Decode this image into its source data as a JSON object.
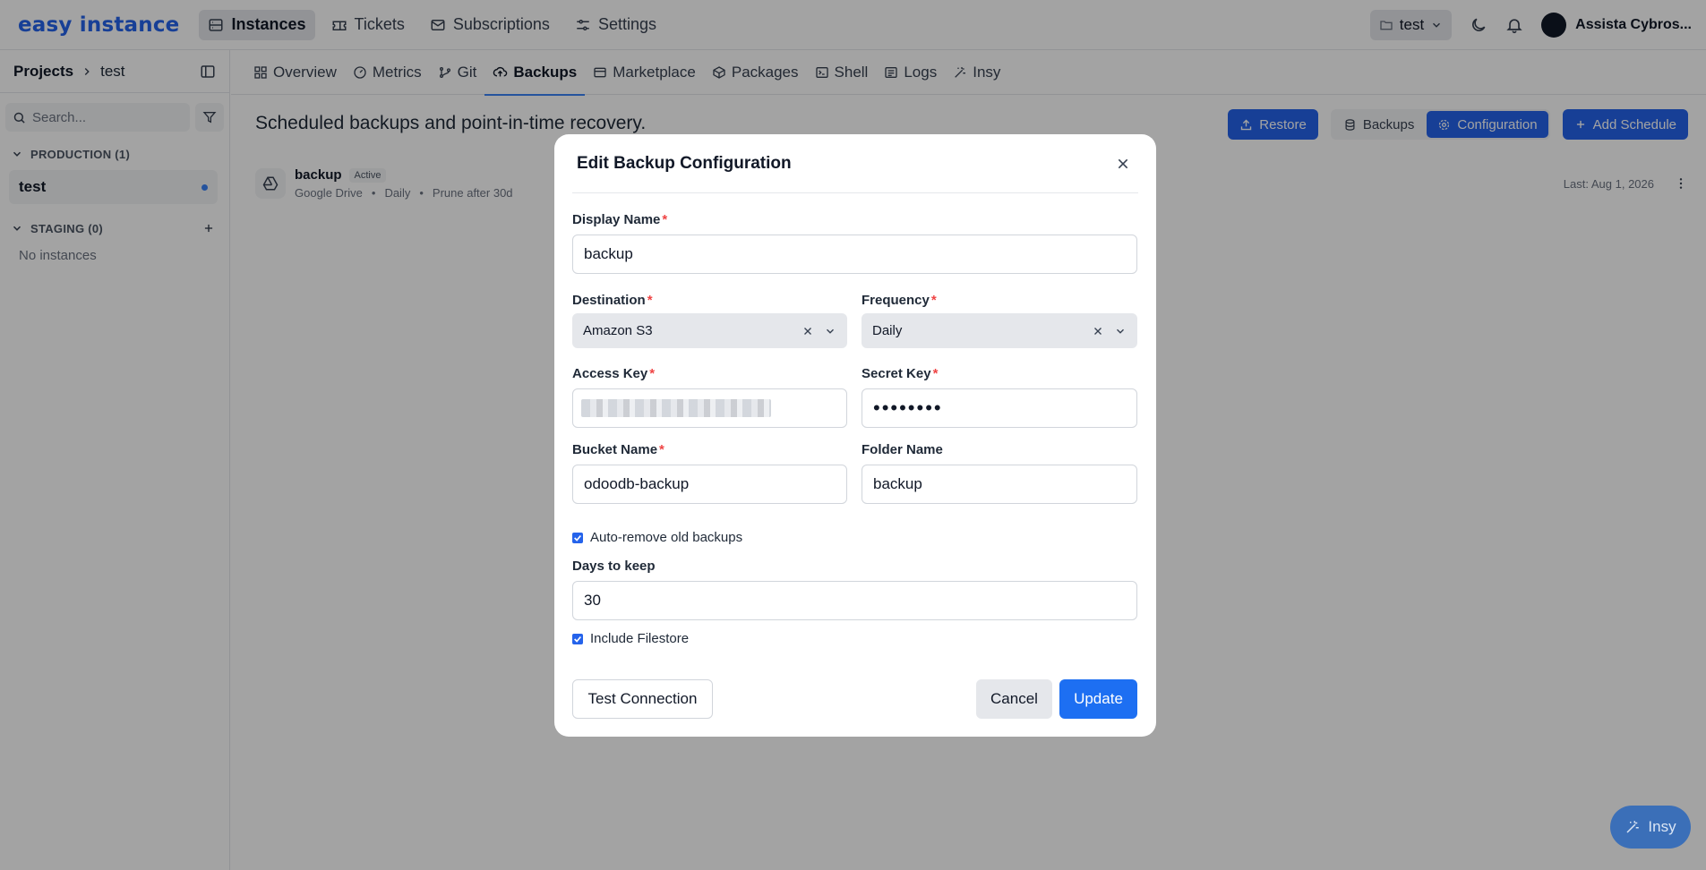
{
  "app": {
    "logo": "easy instance"
  },
  "topnav": {
    "items": [
      {
        "label": "Instances",
        "icon": "server-icon",
        "active": true
      },
      {
        "label": "Tickets",
        "icon": "ticket-icon"
      },
      {
        "label": "Subscriptions",
        "icon": "mail-icon"
      },
      {
        "label": "Settings",
        "icon": "sliders-icon"
      }
    ],
    "project": "test",
    "user": "Assista Cybros..."
  },
  "sidebar": {
    "breadcrumb_root": "Projects",
    "breadcrumb_current": "test",
    "search_placeholder": "Search...",
    "groups": [
      {
        "label": "PRODUCTION (1)",
        "instances": [
          "test"
        ]
      },
      {
        "label": "STAGING (0)",
        "empty": "No instances"
      }
    ]
  },
  "tabs": [
    "Overview",
    "Metrics",
    "Git",
    "Backups",
    "Marketplace",
    "Packages",
    "Shell",
    "Logs",
    "Insy"
  ],
  "active_tab": "Backups",
  "main": {
    "title": "Scheduled backups and point-in-time recovery.",
    "restore_label": "Restore",
    "backups_label": "Backups",
    "configuration_label": "Configuration",
    "add_schedule_label": "Add Schedule",
    "schedule": {
      "name": "backup",
      "status": "Active",
      "destination": "Google Drive",
      "frequency": "Daily",
      "prune": "Prune after 30d",
      "last": "Last: Aug 1, 2026"
    }
  },
  "fab": {
    "label": "Insy"
  },
  "modal": {
    "title": "Edit Backup Configuration",
    "display_name_label": "Display Name",
    "display_name_value": "backup",
    "destination_label": "Destination",
    "destination_value": "Amazon S3",
    "frequency_label": "Frequency",
    "frequency_value": "Daily",
    "access_key_label": "Access Key",
    "secret_key_label": "Secret Key",
    "secret_key_value": "••••••••",
    "bucket_label": "Bucket Name",
    "bucket_value": "odoodb-backup",
    "folder_label": "Folder Name",
    "folder_value": "backup",
    "auto_remove_label": "Auto-remove old backups",
    "auto_remove_checked": true,
    "days_label": "Days to keep",
    "days_value": "30",
    "include_filestore_label": "Include Filestore",
    "include_filestore_checked": true,
    "test_connection_label": "Test Connection",
    "cancel_label": "Cancel",
    "update_label": "Update"
  },
  "colors": {
    "accent": "#2563eb",
    "required": "#ef4444",
    "overlay": "rgba(0,0,0,0.36)"
  }
}
